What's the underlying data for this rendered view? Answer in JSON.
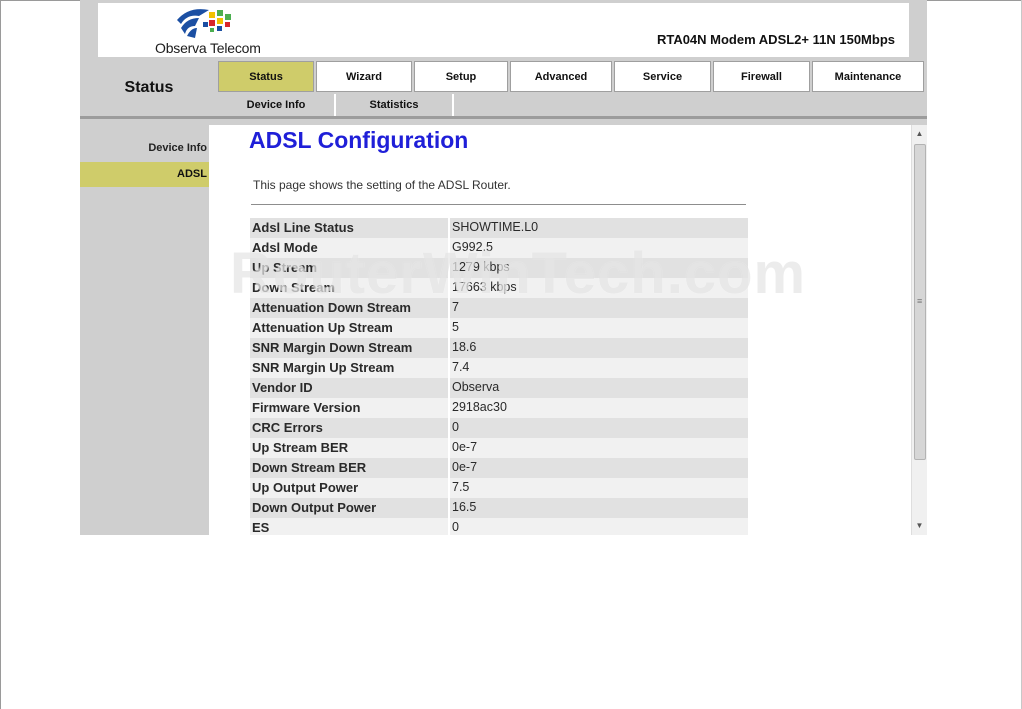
{
  "header": {
    "brand": "Observa Telecom",
    "model": "RTA04N Modem ADSL2+ 11N 150Mbps"
  },
  "nav": {
    "section_title": "Status",
    "tabs": [
      {
        "label": "Status",
        "active": true
      },
      {
        "label": "Wizard"
      },
      {
        "label": "Setup"
      },
      {
        "label": "Advanced"
      },
      {
        "label": "Service"
      },
      {
        "label": "Firewall"
      },
      {
        "label": "Maintenance"
      }
    ],
    "subtabs": [
      {
        "label": "Device Info"
      },
      {
        "label": "Statistics"
      }
    ]
  },
  "sidebar": {
    "items": [
      {
        "label": "Device Info"
      },
      {
        "label": "ADSL",
        "active": true
      }
    ]
  },
  "main": {
    "title": "ADSL Configuration",
    "description": "This page shows the setting of the ADSL Router.",
    "rows": [
      {
        "label": "Adsl Line Status",
        "value": "SHOWTIME.L0"
      },
      {
        "label": "Adsl Mode",
        "value": "G992.5"
      },
      {
        "label": "Up Stream",
        "value": "1279 kbps"
      },
      {
        "label": "Down Stream",
        "value": "17663 kbps"
      },
      {
        "label": "Attenuation Down Stream",
        "value": "7"
      },
      {
        "label": "Attenuation Up Stream",
        "value": "5"
      },
      {
        "label": "SNR Margin Down Stream",
        "value": "18.6"
      },
      {
        "label": "SNR Margin Up Stream",
        "value": "7.4"
      },
      {
        "label": "Vendor ID",
        "value": "Observa"
      },
      {
        "label": "Firmware Version",
        "value": "2918ac30"
      },
      {
        "label": "CRC Errors",
        "value": "0"
      },
      {
        "label": "Up Stream BER",
        "value": "0e-7"
      },
      {
        "label": "Down Stream BER",
        "value": "0e-7"
      },
      {
        "label": "Up Output Power",
        "value": "7.5"
      },
      {
        "label": "Down Output Power",
        "value": "16.5"
      },
      {
        "label": "ES",
        "value": "0"
      }
    ]
  },
  "watermark": "RouterWinTech.com",
  "colors": {
    "accent": "#cfcc6a",
    "title_blue": "#1f1fd8",
    "logo_blue": "#1b4fa3",
    "logo_green": "#4caf50",
    "logo_yellow": "#f2c200",
    "logo_red": "#d8262c"
  },
  "icons": {
    "logo": "observa-globe-icon",
    "scroll_up": "arrow-up-icon",
    "scroll_down": "arrow-down-icon",
    "scroll_grip": "grip-icon"
  }
}
